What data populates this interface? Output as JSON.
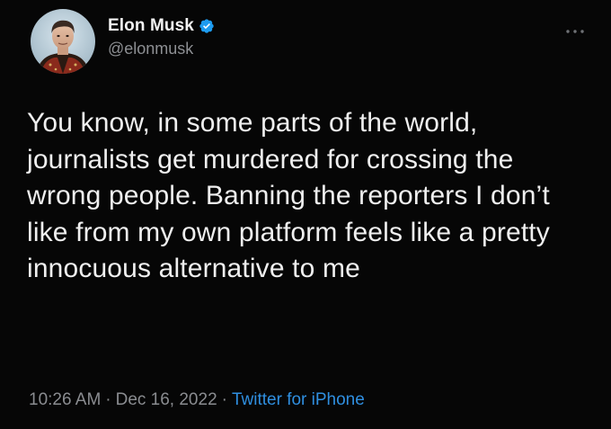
{
  "user": {
    "display_name": "Elon Musk",
    "handle": "@elonmusk",
    "verified": true,
    "avatar_icon": "user-avatar"
  },
  "tweet": {
    "text": "You know, in some parts of the world, journalists get murdered for crossing the wrong people. Banning the reporters I don’t like from my own platform feels like a pretty innocuous alternative to me",
    "time": "10:26 AM",
    "separator": "·",
    "date": "Dec 16, 2022",
    "source": "Twitter for iPhone"
  },
  "icons": {
    "verified": "verified-badge-icon",
    "more": "more-options-icon"
  },
  "colors": {
    "background": "#060606",
    "text_primary": "#efefef",
    "text_secondary": "#8a8c90",
    "link": "#2f8fe0",
    "verified_badge": "#1d9bf0"
  }
}
